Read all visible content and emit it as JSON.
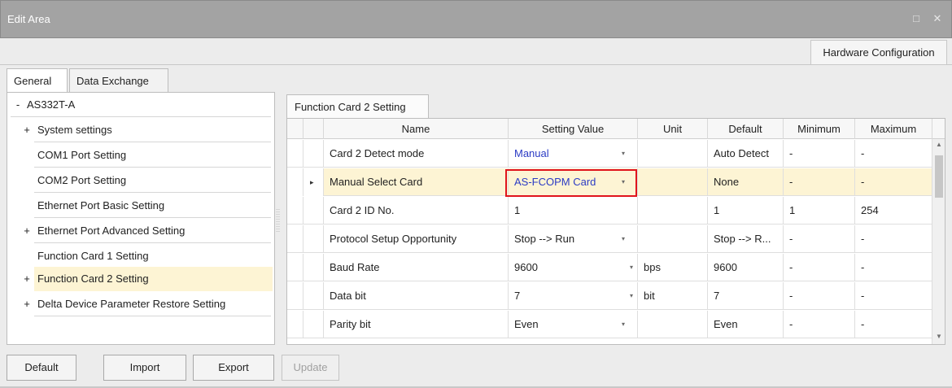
{
  "window": {
    "title": "Edit Area",
    "restore_glyph": "□",
    "close_glyph": "✕"
  },
  "header_tab": "Hardware Configuration",
  "tabs": [
    {
      "label": "General",
      "active": true
    },
    {
      "label": "Data Exchange",
      "active": false
    }
  ],
  "tree": [
    {
      "sign": "-",
      "label": "AS332T-A",
      "level": 0,
      "selected": false
    },
    {
      "sign": "+",
      "label": "System settings",
      "level": 1,
      "selected": false
    },
    {
      "sign": "",
      "label": "COM1 Port Setting",
      "level": 1,
      "selected": false
    },
    {
      "sign": "",
      "label": "COM2 Port Setting",
      "level": 1,
      "selected": false
    },
    {
      "sign": "",
      "label": "Ethernet Port Basic Setting",
      "level": 1,
      "selected": false
    },
    {
      "sign": "+",
      "label": "Ethernet Port Advanced Setting",
      "level": 1,
      "selected": false
    },
    {
      "sign": "",
      "label": "Function Card 1 Setting",
      "level": 1,
      "selected": false
    },
    {
      "sign": "+",
      "label": "Function Card 2 Setting",
      "level": 1,
      "selected": true
    },
    {
      "sign": "+",
      "label": "Delta Device Parameter Restore Setting",
      "level": 1,
      "selected": false
    }
  ],
  "grid_tab": "Function Card 2 Setting",
  "columns": [
    "Name",
    "Setting Value",
    "Unit",
    "Default",
    "Minimum",
    "Maximum"
  ],
  "rows": [
    {
      "name": "Card 2 Detect mode",
      "value": "Manual",
      "dropdown": true,
      "unit": "",
      "default": "Auto Detect",
      "min": "-",
      "max": "-",
      "current": false,
      "highlight": false
    },
    {
      "name": "Manual Select Card",
      "value": "AS-FCOPM Card",
      "dropdown": true,
      "unit": "",
      "default": "None",
      "min": "-",
      "max": "-",
      "current": true,
      "highlight": true
    },
    {
      "name": "Card 2 ID No.",
      "value": "1",
      "dropdown": false,
      "unit": "",
      "default": "1",
      "min": "1",
      "max": "254",
      "current": false,
      "highlight": false
    },
    {
      "name": "Protocol Setup Opportunity",
      "value": "Stop --> Run",
      "dropdown": true,
      "unit": "",
      "default": "Stop --> R...",
      "min": "-",
      "max": "-",
      "current": false,
      "highlight": false
    },
    {
      "name": "Baud Rate",
      "value": "9600",
      "dropdown": true,
      "unit": "bps",
      "default": "9600",
      "min": "-",
      "max": "-",
      "current": false,
      "highlight": false
    },
    {
      "name": "Data bit",
      "value": "7",
      "dropdown": true,
      "unit": "bit",
      "default": "7",
      "min": "-",
      "max": "-",
      "current": false,
      "highlight": false
    },
    {
      "name": "Parity bit",
      "value": "Even",
      "dropdown": true,
      "unit": "",
      "default": "Even",
      "min": "-",
      "max": "-",
      "current": false,
      "highlight": false
    }
  ],
  "buttons": {
    "default": "Default",
    "import": "Import",
    "export": "Export",
    "update": "Update"
  },
  "colors": {
    "selected_row": "#fdf4d4",
    "value_text": "#2b3bc4",
    "highlight_box": "#e0141c"
  },
  "icons": {
    "dropdown": "▾",
    "row_indicator": "▸",
    "scroll_up": "▲",
    "scroll_down": "▼"
  }
}
